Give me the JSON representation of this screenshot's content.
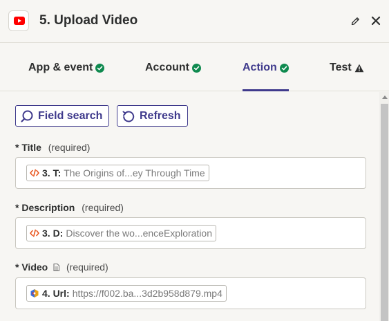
{
  "header": {
    "title": "5. Upload Video",
    "app_icon": "youtube-icon",
    "edit_icon": "pencil-icon",
    "close_icon": "close-icon"
  },
  "tabs": [
    {
      "label": "App & event",
      "status": "complete"
    },
    {
      "label": "Account",
      "status": "complete"
    },
    {
      "label": "Action",
      "status": "complete",
      "active": true
    },
    {
      "label": "Test",
      "status": "warning"
    }
  ],
  "toolbar": {
    "field_search_label": "Field search",
    "refresh_label": "Refresh"
  },
  "fields": [
    {
      "label": "Title",
      "required_text": "(required)",
      "step": "3. T:",
      "value": "The Origins of...ey Through Time",
      "icon": "code-icon"
    },
    {
      "label": "Description",
      "required_text": "(required)",
      "step": "3. D:",
      "value": "Discover the wo...enceExploration",
      "icon": "code-icon"
    },
    {
      "label": "Video",
      "required_text": "(required)",
      "step": "4. Url:",
      "value": "https://f002.ba...3d2b958d879.mp4",
      "icon": "backblaze-icon",
      "label_icon": "document-icon"
    }
  ],
  "required_marker": "*",
  "colors": {
    "accent": "#3f3a8c",
    "success": "#0f8a4f",
    "youtube": "#ff0000",
    "code_icon": "#e8561f"
  }
}
